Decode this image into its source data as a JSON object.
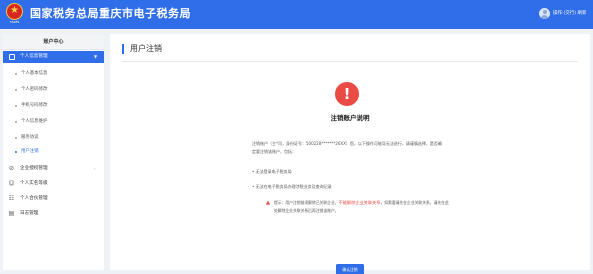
{
  "header": {
    "emblem_caption": "TAXES",
    "title": "国家税务总局重庆市电子税务局",
    "user_name": "操作:(交行) 刷新"
  },
  "sidebar": {
    "title": "账户中心",
    "active_group": "个人信息管理",
    "sub_items": [
      "个人基本信息",
      "个人密码修改",
      "手机号码修改",
      "个人信息维护",
      "服务协议",
      "用户注销"
    ],
    "menus": [
      {
        "label": "企业授权管理",
        "icon": "check-circle-icon"
      },
      {
        "label": "个人实名等级",
        "icon": "person-icon"
      },
      {
        "label": "个人合伙管理",
        "icon": "group-icon"
      },
      {
        "label": "日志管理",
        "icon": "log-icon"
      }
    ]
  },
  "main": {
    "page_title": "用户注销",
    "heading": "注销账户说明",
    "paragraph": "注销账户（主*司，身份证号：500228*******26XX）您，以下操作可能导无法进行，请谨慎选择，是否确定要注销该账户，包括：",
    "bullets": [
      "• 无法登录电子税务局",
      "• 无法在电子税务局办理涉税业务及查询记录"
    ],
    "note_prefix": "提示：用户注销前须解除已关联企业，",
    "note_highlight": "不能解除企业关联关系",
    "note_suffix": "，如需要请先在企业关联关系，请先在此处解除企业关联关系后再注销该账户。",
    "confirm_button": "确认注销"
  },
  "colors": {
    "brand_blue": "#2f6ee8",
    "warning_red": "#ea4b45"
  }
}
